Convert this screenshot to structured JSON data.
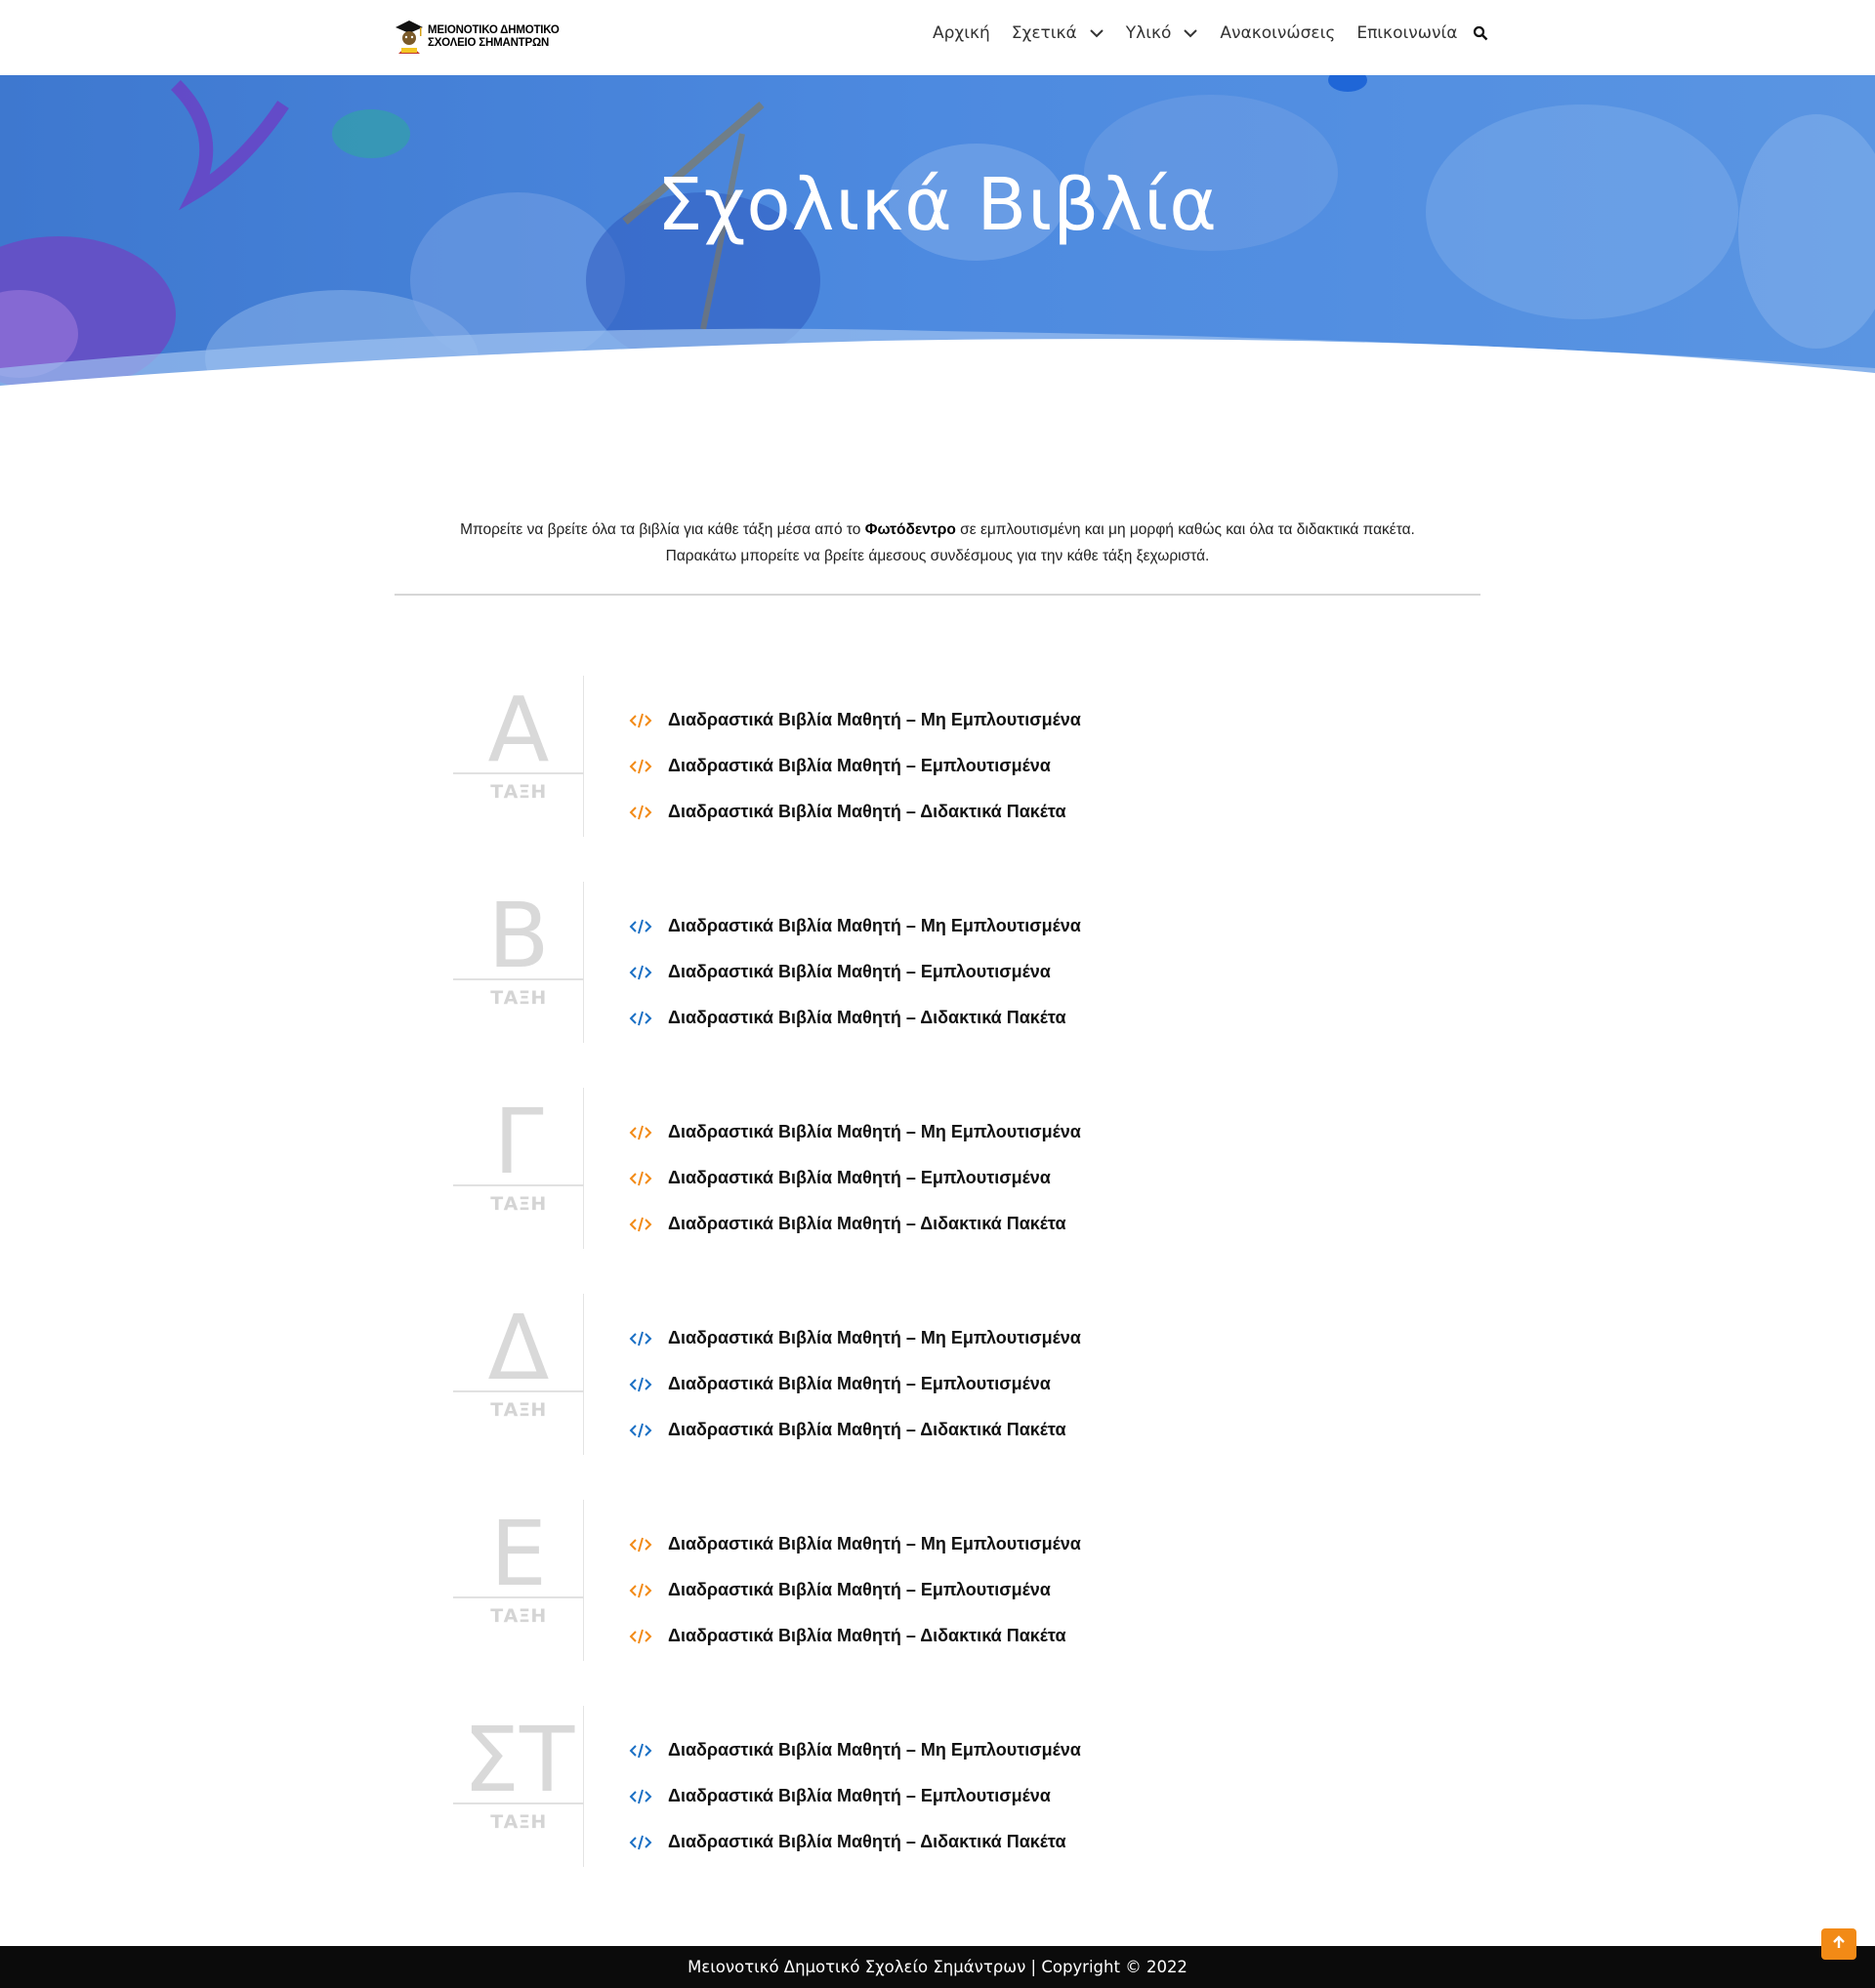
{
  "header": {
    "logo_line1": "ΜΕΙΟΝΟΤΙΚΟ ΔΗΜΟΤΙΚΟ",
    "logo_line2": "ΣΧΟΛΕΙΟ ΣΗΜΑΝΤΡΩΝ",
    "nav": [
      {
        "label": "Αρχική",
        "dropdown": false
      },
      {
        "label": "Σχετικά",
        "dropdown": true
      },
      {
        "label": "Υλικό",
        "dropdown": true
      },
      {
        "label": "Ανακοινώσεις",
        "dropdown": false
      },
      {
        "label": "Επικοινωνία",
        "dropdown": false
      }
    ],
    "search_icon": "search-icon"
  },
  "hero": {
    "title": "Σχολικά Βιβλία"
  },
  "intro": {
    "line1_before": "Μπορείτε να βρείτε όλα τα βιβλία για κάθε τάξη μέσα από το ",
    "line1_bold": "Φωτόδεντρο",
    "line1_after": " σε εμπλουτισμένη και μη μορφή καθώς και όλα τα διδακτικά πακέτα.",
    "line2": "Παρακάτω μπορείτε να βρείτε άμεσους συνδέσμους για την κάθε τάξη ξεχωριστά."
  },
  "colors": {
    "accent_orange": "#f28a16",
    "accent_blue": "#1a6fc4"
  },
  "classes": [
    {
      "letter": "Α",
      "sub": "ΤΑΞΗ",
      "icon_color": "#f28a16",
      "links": [
        "Διαδραστικά Βιβλία Μαθητή – Μη Εμπλουτισμένα",
        "Διαδραστικά Βιβλία Μαθητή – Εμπλουτισμένα",
        "Διαδραστικά Βιβλία Μαθητή – Διδακτικά Πακέτα"
      ]
    },
    {
      "letter": "Β",
      "sub": "ΤΑΞΗ",
      "icon_color": "#1a6fc4",
      "links": [
        "Διαδραστικά Βιβλία Μαθητή – Μη Εμπλουτισμένα",
        "Διαδραστικά Βιβλία Μαθητή – Εμπλουτισμένα",
        "Διαδραστικά Βιβλία Μαθητή – Διδακτικά Πακέτα"
      ]
    },
    {
      "letter": "Γ",
      "sub": "ΤΑΞΗ",
      "icon_color": "#f28a16",
      "links": [
        "Διαδραστικά Βιβλία Μαθητή – Μη Εμπλουτισμένα",
        "Διαδραστικά Βιβλία Μαθητή – Εμπλουτισμένα",
        "Διαδραστικά Βιβλία Μαθητή – Διδακτικά Πακέτα"
      ]
    },
    {
      "letter": "Δ",
      "sub": "ΤΑΞΗ",
      "icon_color": "#1a6fc4",
      "links": [
        "Διαδραστικά Βιβλία Μαθητή – Μη Εμπλουτισμένα",
        "Διαδραστικά Βιβλία Μαθητή – Εμπλουτισμένα",
        "Διαδραστικά Βιβλία Μαθητή – Διδακτικά Πακέτα"
      ]
    },
    {
      "letter": "Ε",
      "sub": "ΤΑΞΗ",
      "icon_color": "#f28a16",
      "links": [
        "Διαδραστικά Βιβλία Μαθητή – Μη Εμπλουτισμένα",
        "Διαδραστικά Βιβλία Μαθητή – Εμπλουτισμένα",
        "Διαδραστικά Βιβλία Μαθητή – Διδακτικά Πακέτα"
      ]
    },
    {
      "letter": "ΣΤ",
      "sub": "ΤΑΞΗ",
      "icon_color": "#1a6fc4",
      "links": [
        "Διαδραστικά Βιβλία Μαθητή – Μη Εμπλουτισμένα",
        "Διαδραστικά Βιβλία Μαθητή – Εμπλουτισμένα",
        "Διαδραστικά Βιβλία Μαθητή – Διδακτικά Πακέτα"
      ]
    }
  ],
  "footer": {
    "text": "Μειονοτικό Δημοτικό Σχολείο Σημάντρων | Copyright © 2022"
  },
  "back_to_top_icon": "arrow-up-icon"
}
